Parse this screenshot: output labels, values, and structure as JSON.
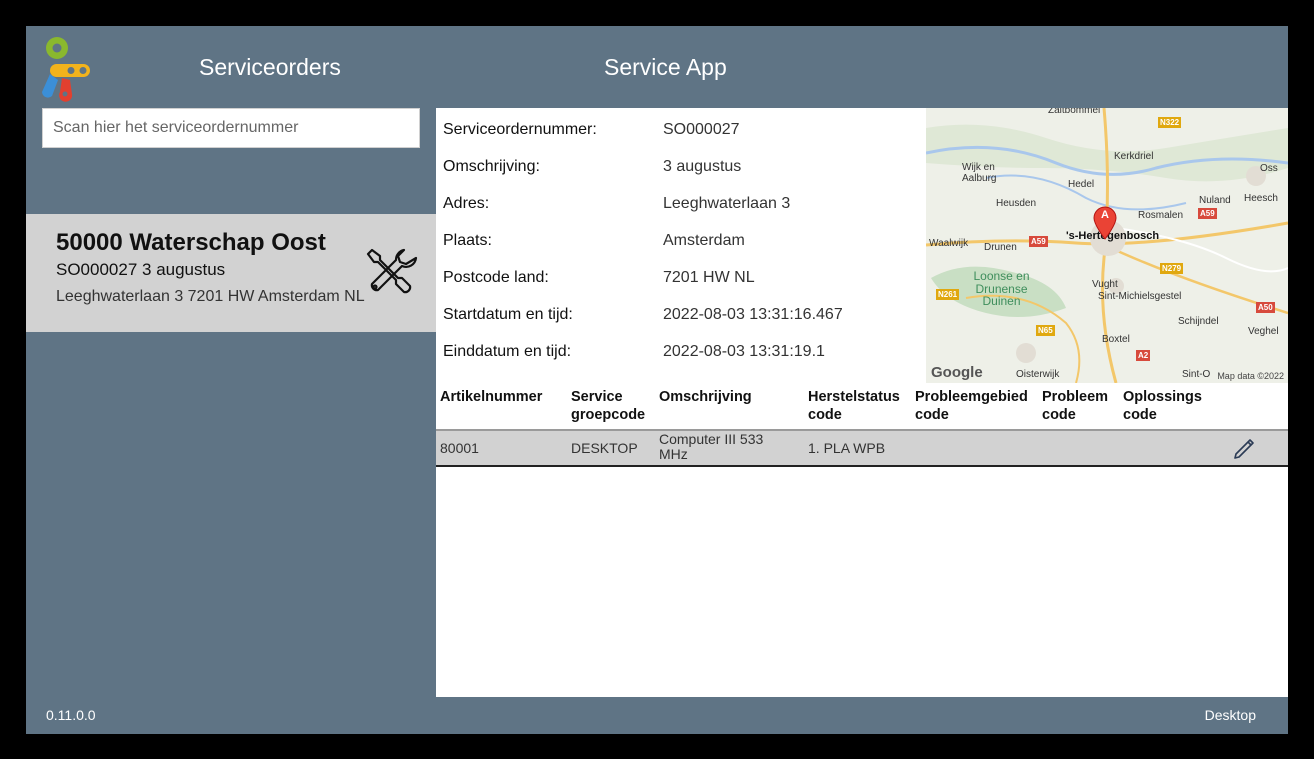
{
  "header": {
    "left_title": "Serviceorders",
    "app_title": "Service App"
  },
  "search": {
    "placeholder": "Scan hier het serviceordernummer",
    "value": ""
  },
  "order_card": {
    "title": "50000 Waterschap Oost",
    "subtitle": "SO000027 3 augustus",
    "address": "Leeghwaterlaan 3 7201 HW Amsterdam NL",
    "icon": "tools-icon"
  },
  "details": {
    "fields": [
      {
        "label": "Serviceordernummer:",
        "value": "SO000027"
      },
      {
        "label": "Omschrijving:",
        "value": "3 augustus"
      },
      {
        "label": "Adres:",
        "value": "Leeghwaterlaan 3"
      },
      {
        "label": "Plaats:",
        "value": "Amsterdam"
      },
      {
        "label": "Postcode land:",
        "value": "7201 HW NL"
      },
      {
        "label": "Startdatum en tijd:",
        "value": "2022-08-03 13:31:16.467"
      },
      {
        "label": "Einddatum en tijd:",
        "value": "2022-08-03 13:31:19.1"
      }
    ]
  },
  "map": {
    "places": [
      "Zaltbommel",
      "Kerkdriel",
      "Wijk en Aalburg",
      "Hedel",
      "Oss",
      "Heusden",
      "Nuland",
      "Heesch",
      "Rosmalen",
      "Waalwijk",
      "Drunen",
      "'s-Hertogenbosch",
      "Loonse en Drunense Duinen",
      "Vught",
      "Sint-Michielsgestel",
      "Schijndel",
      "Veghel",
      "Boxtel",
      "Oisterwijk",
      "Sint-O"
    ],
    "roads": [
      "N322",
      "A59",
      "A59",
      "N279",
      "N261",
      "A50",
      "N65",
      "A2"
    ],
    "marker": "A",
    "logo": "Google",
    "attribution": "Map data ©2022"
  },
  "table": {
    "headers": [
      "Artikelnummer",
      "Service groepcode",
      "Omschrijving",
      "Herstelstatus code",
      "Probleemgebied code",
      "Probleem code",
      "Oplossings code"
    ],
    "rows": [
      {
        "artikelnummer": "80001",
        "groepcode": "DESKTOP",
        "omschrijving": "Computer III 533 MHz",
        "herstelstatus": "1. PLA WPB",
        "probleemgebied": "",
        "probleem": "",
        "oplossing": ""
      }
    ],
    "row_action_icon": "pencil-icon"
  },
  "footer": {
    "version": "0.11.0.0",
    "device": "Desktop"
  },
  "colors": {
    "panel": "#5f7485",
    "card": "#d2d2d2",
    "logo_green": "#8ab82e",
    "logo_yellow": "#f2b31c",
    "logo_blue": "#3b8fd8",
    "logo_red": "#e2402f",
    "map_marker": "#ea4335"
  }
}
